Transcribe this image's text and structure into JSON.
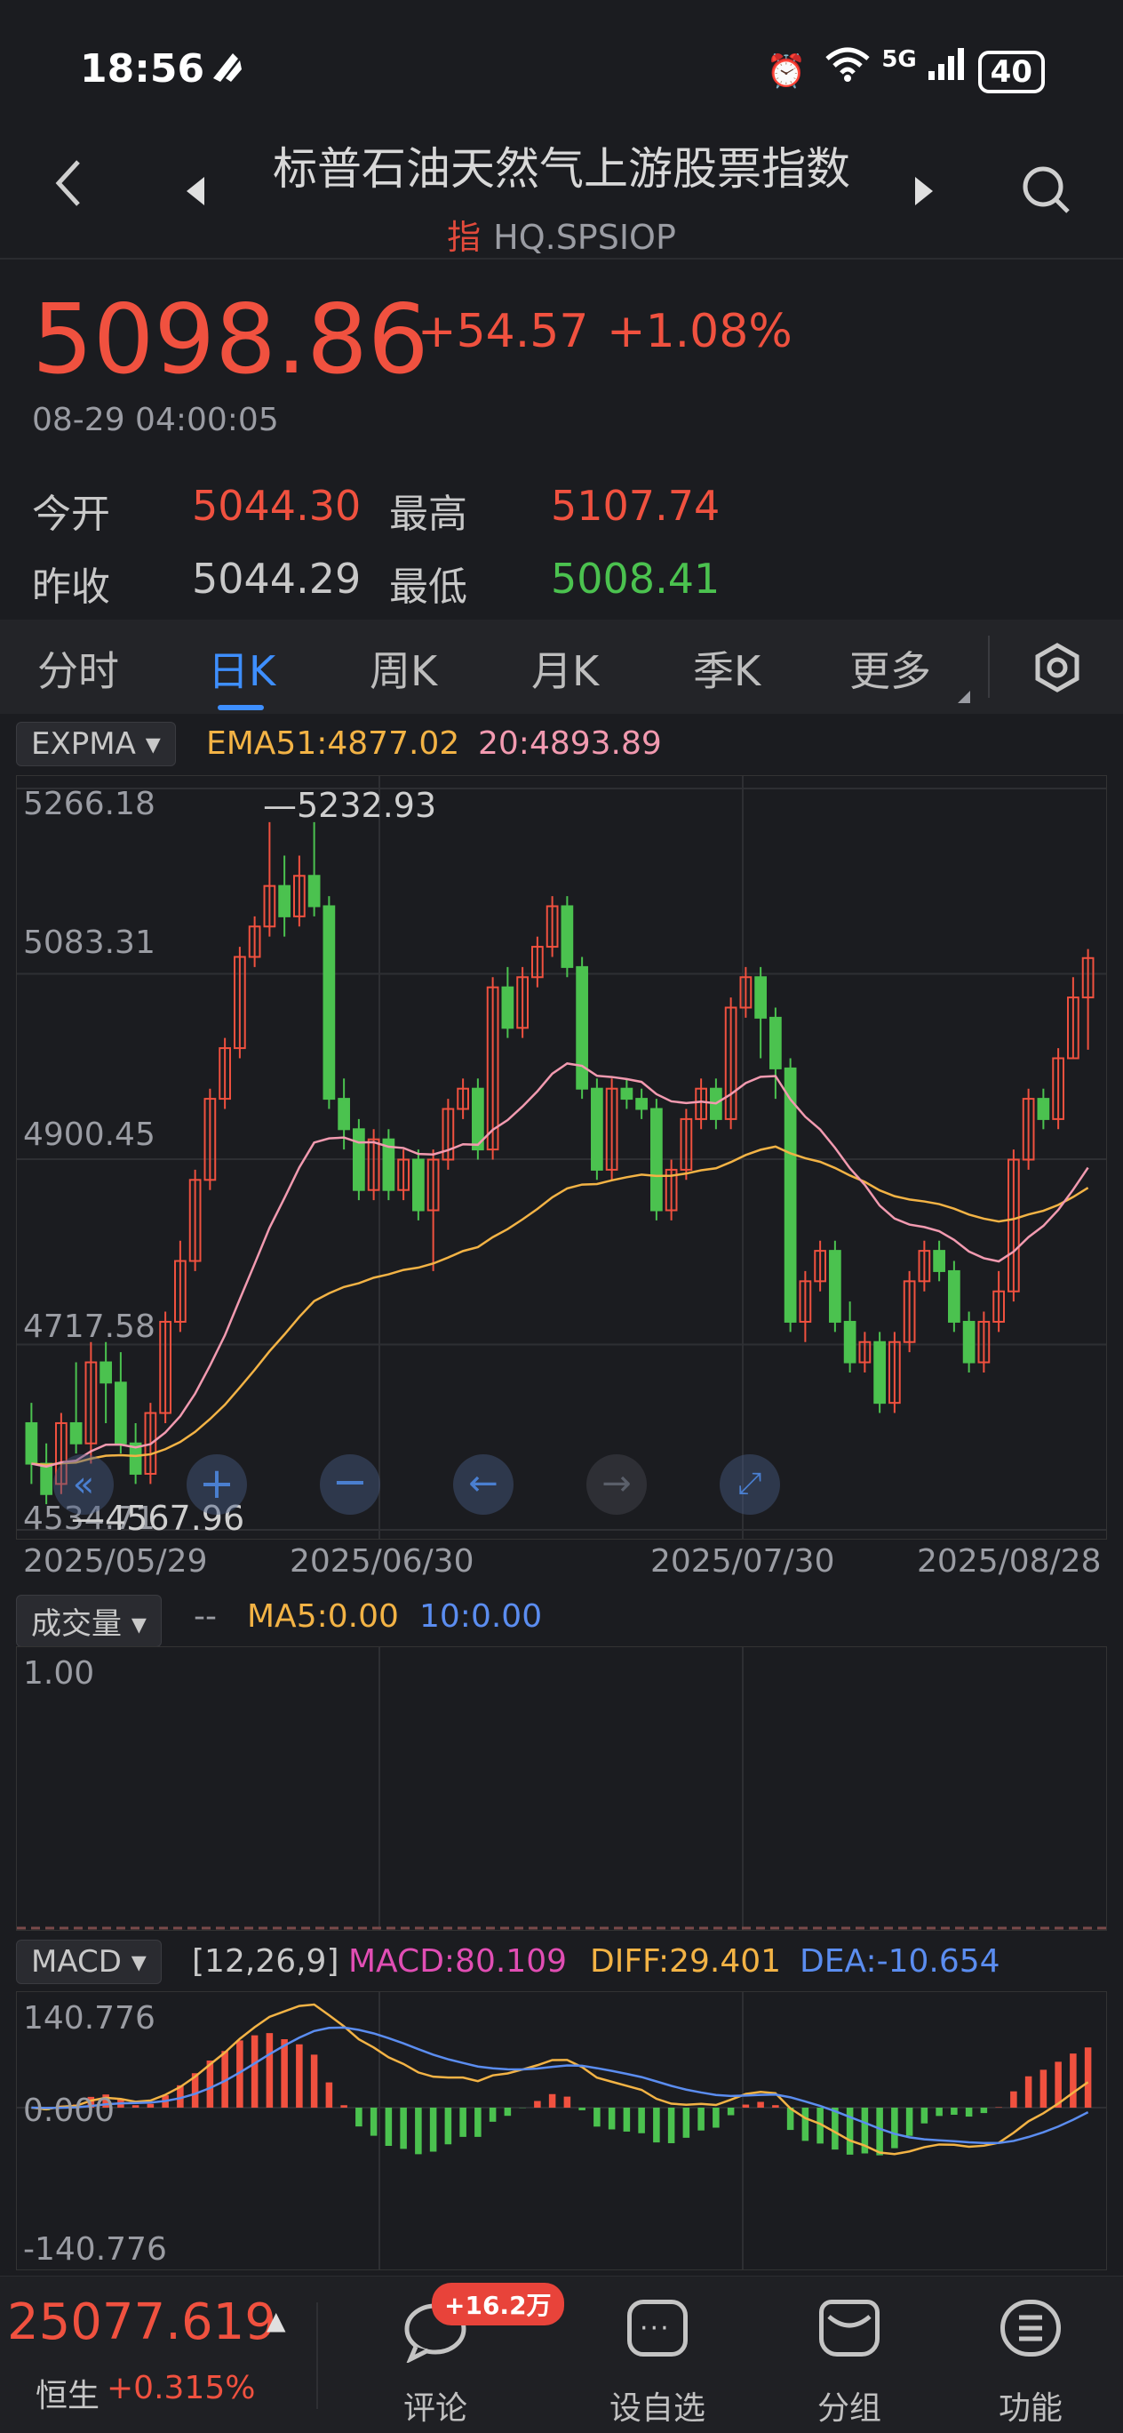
{
  "status_bar": {
    "time": "18:56",
    "network": "5G",
    "battery": "40"
  },
  "header": {
    "title": "标普石油天然气上游股票指数",
    "badge": "指",
    "code": "HQ.SPSIOP"
  },
  "quote": {
    "price": "5098.86",
    "change": "+54.57",
    "change_pct": "+1.08%",
    "timestamp": "08-29 04:00:05",
    "open_label": "今开",
    "open": "5044.30",
    "high_label": "最高",
    "high": "5107.74",
    "prev_close_label": "昨收",
    "prev_close": "5044.29",
    "low_label": "最低",
    "low": "5008.41"
  },
  "tabs": [
    "分时",
    "日K",
    "周K",
    "月K",
    "季K",
    "更多"
  ],
  "active_tab": "日K",
  "kline": {
    "indicator": "EXPMA",
    "ema_a": "EMA51:4877.02",
    "ema_b": "20:4893.89",
    "y_labels": [
      "5266.18",
      "5083.31",
      "4900.45",
      "4717.58",
      "4534.71"
    ],
    "max_label": "5232.93",
    "min_label": "4567.96",
    "x_labels": [
      "2025/05/29",
      "2025/06/30",
      "2025/07/30",
      "2025/08/28"
    ]
  },
  "volume": {
    "selector": "成交量",
    "dash": "--",
    "ma5": "MA5:0.00",
    "ma10": "10:0.00",
    "y_label": "1.00"
  },
  "macd": {
    "selector": "MACD",
    "params": "[12,26,9]",
    "macd": "MACD:80.109",
    "diff": "DIFF:29.401",
    "dea": "DEA:-10.654",
    "y_labels": [
      "140.776",
      "0.000",
      "-140.776"
    ]
  },
  "bottom": {
    "hsi_value": "25077.619",
    "hsi_label": "恒生",
    "hsi_pct": "+0.315%",
    "comment_badge": "+16.2万",
    "nav": [
      "评论",
      "设自选",
      "分组",
      "功能"
    ]
  },
  "colors": {
    "up": "#f0513f",
    "down": "#4bc24f",
    "accent": "#3e8fff",
    "ema_short": "#f29ab0",
    "ema_long": "#f3b345"
  },
  "chart_data": [
    {
      "type": "candlestick",
      "title": "日K",
      "ylim": [
        4534.71,
        5266.18
      ],
      "x_range": [
        "2025/05/29",
        "2025/08/28"
      ],
      "series": [
        {
          "name": "EMA51",
          "type": "line"
        },
        {
          "name": "20",
          "type": "line"
        }
      ],
      "candles": [
        [
          4640,
          4600,
          4660,
          4580
        ],
        [
          4600,
          4570,
          4620,
          4560
        ],
        [
          4580,
          4640,
          4650,
          4570
        ],
        [
          4640,
          4620,
          4700,
          4610
        ],
        [
          4620,
          4700,
          4720,
          4600
        ],
        [
          4700,
          4680,
          4720,
          4640
        ],
        [
          4680,
          4620,
          4710,
          4610
        ],
        [
          4620,
          4590,
          4640,
          4580
        ],
        [
          4590,
          4650,
          4660,
          4580
        ],
        [
          4650,
          4740,
          4750,
          4640
        ],
        [
          4740,
          4800,
          4820,
          4730
        ],
        [
          4800,
          4880,
          4890,
          4790
        ],
        [
          4880,
          4960,
          4970,
          4870
        ],
        [
          4960,
          5010,
          5020,
          4950
        ],
        [
          5010,
          5100,
          5110,
          5000
        ],
        [
          5100,
          5130,
          5140,
          5090
        ],
        [
          5130,
          5170,
          5232.93,
          5120
        ],
        [
          5170,
          5140,
          5200,
          5120
        ],
        [
          5140,
          5180,
          5200,
          5130
        ],
        [
          5180,
          5150,
          5232.93,
          5140
        ],
        [
          5150,
          4960,
          5160,
          4950
        ],
        [
          4960,
          4930,
          4980,
          4910
        ],
        [
          4930,
          4870,
          4940,
          4860
        ],
        [
          4870,
          4920,
          4930,
          4860
        ],
        [
          4920,
          4870,
          4930,
          4860
        ],
        [
          4870,
          4900,
          4910,
          4860
        ],
        [
          4900,
          4850,
          4910,
          4840
        ],
        [
          4850,
          4900,
          4910,
          4790
        ],
        [
          4900,
          4950,
          4960,
          4890
        ],
        [
          4950,
          4970,
          4980,
          4940
        ],
        [
          4970,
          4910,
          4980,
          4900
        ],
        [
          4910,
          5070,
          5080,
          4900
        ],
        [
          5070,
          5030,
          5090,
          5020
        ],
        [
          5030,
          5080,
          5090,
          5020
        ],
        [
          5080,
          5110,
          5120,
          5070
        ],
        [
          5110,
          5150,
          5160,
          5100
        ],
        [
          5150,
          5090,
          5160,
          5080
        ],
        [
          5090,
          4970,
          5100,
          4960
        ],
        [
          4970,
          4890,
          4980,
          4880
        ],
        [
          4890,
          4970,
          4980,
          4880
        ],
        [
          4970,
          4960,
          4980,
          4950
        ],
        [
          4960,
          4950,
          4970,
          4940
        ],
        [
          4950,
          4850,
          4960,
          4840
        ],
        [
          4850,
          4890,
          4900,
          4840
        ],
        [
          4890,
          4940,
          4950,
          4880
        ],
        [
          4940,
          4970,
          4980,
          4930
        ],
        [
          4970,
          4940,
          4980,
          4930
        ],
        [
          4940,
          5050,
          5060,
          4930
        ],
        [
          5050,
          5080,
          5090,
          5040
        ],
        [
          5080,
          5040,
          5090,
          5000
        ],
        [
          5040,
          4990,
          5050,
          4960
        ],
        [
          4990,
          4740,
          5000,
          4730
        ],
        [
          4740,
          4780,
          4790,
          4720
        ],
        [
          4780,
          4810,
          4820,
          4770
        ],
        [
          4810,
          4740,
          4820,
          4730
        ],
        [
          4740,
          4700,
          4760,
          4690
        ],
        [
          4700,
          4720,
          4730,
          4690
        ],
        [
          4720,
          4660,
          4730,
          4650
        ],
        [
          4660,
          4720,
          4730,
          4650
        ],
        [
          4720,
          4780,
          4790,
          4710
        ],
        [
          4780,
          4810,
          4820,
          4770
        ],
        [
          4810,
          4790,
          4820,
          4780
        ],
        [
          4790,
          4740,
          4800,
          4730
        ],
        [
          4740,
          4700,
          4750,
          4690
        ],
        [
          4700,
          4740,
          4750,
          4690
        ],
        [
          4740,
          4770,
          4790,
          4730
        ],
        [
          4770,
          4900,
          4910,
          4760
        ],
        [
          4900,
          4960,
          4970,
          4890
        ],
        [
          4960,
          4940,
          4970,
          4930
        ],
        [
          4940,
          5000,
          5010,
          4930
        ],
        [
          5000,
          5060,
          5080,
          5000
        ],
        [
          5060,
          5098.86,
          5107.74,
          5008.41
        ]
      ]
    },
    {
      "type": "bar",
      "title": "MACD",
      "ylim": [
        -140.776,
        140.776
      ],
      "series": [
        {
          "name": "MACD",
          "type": "bar"
        },
        {
          "name": "DIFF",
          "type": "line"
        },
        {
          "name": "DEA",
          "type": "line"
        }
      ]
    }
  ]
}
